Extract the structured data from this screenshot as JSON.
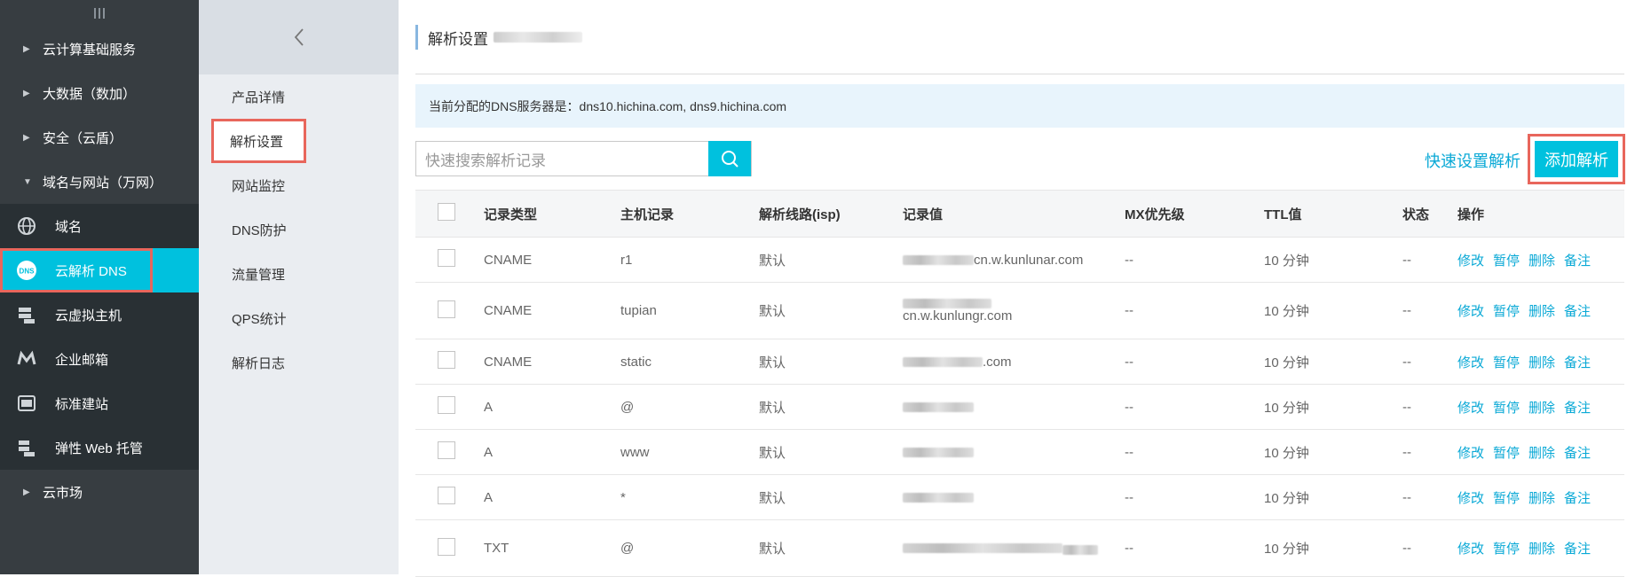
{
  "left_nav": {
    "groups_top": [
      {
        "label": "云计算基础服务"
      },
      {
        "label": "大数据（数加）"
      },
      {
        "label": "安全（云盾）"
      }
    ],
    "expanded_group": {
      "label": "域名与网站（万网）"
    },
    "items": [
      {
        "label": "域名",
        "icon": "globe-icon"
      },
      {
        "label": "云解析 DNS",
        "icon": "dns-icon"
      },
      {
        "label": "云虚拟主机",
        "icon": "server-icon"
      },
      {
        "label": "企业邮箱",
        "icon": "mail-icon"
      },
      {
        "label": "标准建站",
        "icon": "site-icon"
      },
      {
        "label": "弹性 Web 托管",
        "icon": "web-hosting-icon"
      }
    ],
    "bottom_group": {
      "label": "云市场"
    }
  },
  "sub_nav": {
    "items": [
      {
        "label": "产品详情"
      },
      {
        "label": "解析设置"
      },
      {
        "label": "网站监控"
      },
      {
        "label": "DNS防护"
      },
      {
        "label": "流量管理"
      },
      {
        "label": "QPS统计"
      },
      {
        "label": "解析日志"
      }
    ]
  },
  "main": {
    "title": "解析设置",
    "dns_info": "当前分配的DNS服务器是：dns10.hichina.com, dns9.hichina.com",
    "search_placeholder": "快速搜索解析记录",
    "quick_setup": "快速设置解析",
    "add_button": "添加解析"
  },
  "table": {
    "headers": [
      "记录类型",
      "主机记录",
      "解析线路(isp)",
      "记录值",
      "MX优先级",
      "TTL值",
      "状态",
      "操作"
    ],
    "rows": [
      {
        "type": "CNAME",
        "host": "r1",
        "line": "默认",
        "value_suffix": "cn.w.kunlunar.com",
        "mx": "--",
        "ttl": "10 分钟",
        "status": "--"
      },
      {
        "type": "CNAME",
        "host": "tupian",
        "line": "默认",
        "value_suffix": "cn.w.kunlungr.com",
        "mx": "--",
        "ttl": "10 分钟",
        "status": "--"
      },
      {
        "type": "CNAME",
        "host": "static",
        "line": "默认",
        "value_suffix": ".com",
        "mx": "--",
        "ttl": "10 分钟",
        "status": "--"
      },
      {
        "type": "A",
        "host": "@",
        "line": "默认",
        "value_suffix": "",
        "mx": "--",
        "ttl": "10 分钟",
        "status": "--"
      },
      {
        "type": "A",
        "host": "www",
        "line": "默认",
        "value_suffix": "",
        "mx": "--",
        "ttl": "10 分钟",
        "status": "--"
      },
      {
        "type": "A",
        "host": "*",
        "line": "默认",
        "value_suffix": "",
        "mx": "--",
        "ttl": "10 分钟",
        "status": "--"
      },
      {
        "type": "TXT",
        "host": "@",
        "line": "默认",
        "value_suffix": "",
        "mx": "--",
        "ttl": "10 分钟",
        "status": "--"
      }
    ],
    "ops": [
      "修改",
      "暂停",
      "删除",
      "备注"
    ]
  },
  "colors": {
    "accent": "#00c1de",
    "highlight": "#e8665c",
    "link": "#0aa9d6",
    "nav_bg": "#373d41"
  }
}
